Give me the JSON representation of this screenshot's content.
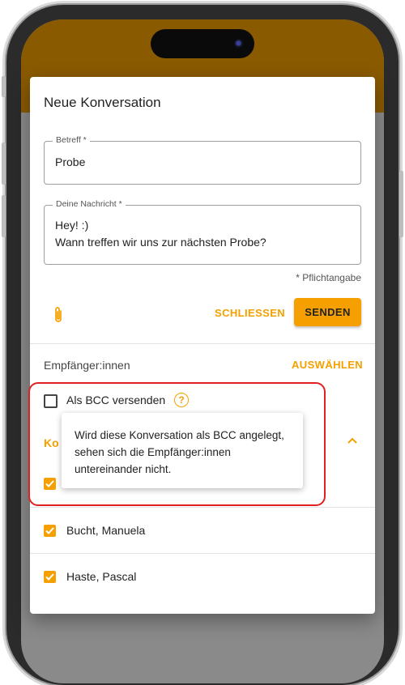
{
  "dialog": {
    "title": "Neue Konversation",
    "subject": {
      "label": "Betreff *",
      "value": "Probe"
    },
    "message": {
      "label": "Deine Nachricht *",
      "line1": "Hey! :)",
      "line2": "Wann treffen wir uns zur nächsten Probe?"
    },
    "required_note": "* Pflichtangabe",
    "attach_icon": "paperclip-icon",
    "close_label": "SCHLIESSEN",
    "send_label": "SENDEN",
    "recipients_label": "Empfänger:innen",
    "select_label": "AUSWÄHLEN",
    "bcc": {
      "label": "Als BCC versenden",
      "checked": false,
      "help_icon": "question-circle-icon"
    },
    "group": {
      "label_visible": "Ko",
      "expanded": true
    },
    "recipients": [
      {
        "name": "",
        "checked": true
      },
      {
        "name": "Bucht, Manuela",
        "checked": true
      },
      {
        "name": "Haste, Pascal",
        "checked": true
      }
    ],
    "tooltip": "Wird diese Konversation als BCC angelegt, sehen sich die Empfänger:innen untereinander nicht."
  },
  "colors": {
    "accent": "#f5a000",
    "highlight": "#e02020",
    "app_bar": "#8a5a00"
  }
}
